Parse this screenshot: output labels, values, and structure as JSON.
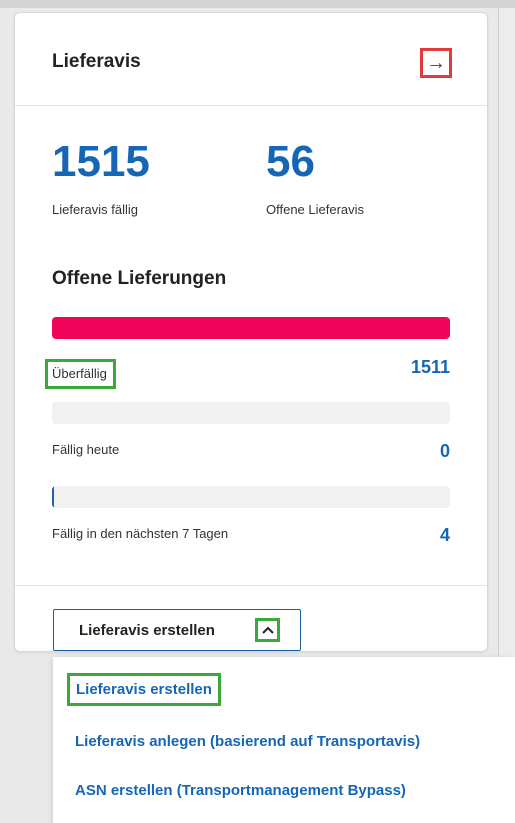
{
  "colors": {
    "accent": "#1567b6",
    "overdue_bar": "#f0055a",
    "today_bar": "#1567b6",
    "highlight_red": "#e23b3b",
    "highlight_green": "#3aa93a"
  },
  "card": {
    "title": "Lieferavis",
    "nav_icon": "arrow-right-icon",
    "nav_glyph": "→"
  },
  "kpis": [
    {
      "value": "1515",
      "label": "Lieferavis fällig"
    },
    {
      "value": "56",
      "label": "Offene Lieferavis"
    }
  ],
  "deliveries": {
    "title": "Offene Lieferungen",
    "rows": [
      {
        "label": "Überfällig",
        "value": "1511",
        "fill_fraction": 1.0
      },
      {
        "label": "Fällig heute",
        "value": "0",
        "fill_fraction": 0.0
      },
      {
        "label": "Fällig in den nächsten 7 Tagen",
        "value": "4",
        "fill_fraction": 0.004
      }
    ]
  },
  "create_button": {
    "label": "Lieferavis erstellen",
    "toggle_icon": "chevron-up-icon",
    "toggle_glyph": "^"
  },
  "dropdown": {
    "items": [
      "Lieferavis erstellen",
      "Lieferavis anlegen (basierend auf Transportavis)",
      "ASN erstellen (Transportmanagement Bypass)"
    ]
  }
}
